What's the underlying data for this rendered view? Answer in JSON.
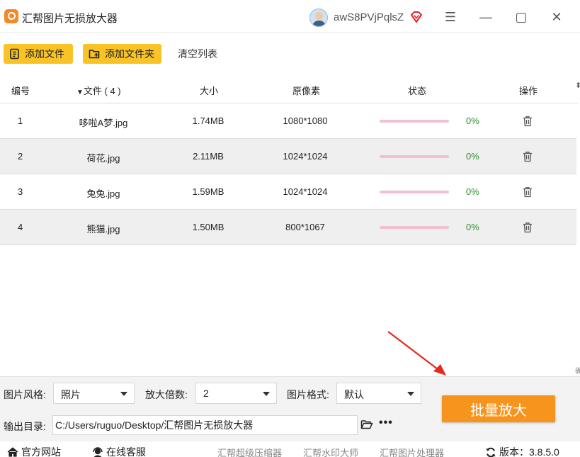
{
  "window": {
    "title": "汇帮图片无损放大器",
    "username": "awS8PVjPqlsZ",
    "controls": {
      "menu": "☰",
      "minimize": "—",
      "maximize": "▢",
      "close": "✕"
    }
  },
  "toolbar": {
    "add_file_label": "添加文件",
    "add_folder_label": "添加文件夹",
    "clear_list_label": "清空列表"
  },
  "table": {
    "headers": {
      "index": "编号",
      "file": "文件 ( 4 )",
      "size": "大小",
      "pixels": "原像素",
      "status": "状态",
      "action": "操作"
    },
    "rows": [
      {
        "index": "1",
        "file": "哆啦A梦.jpg",
        "size": "1.74MB",
        "pixels": "1080*1080",
        "progress": 0,
        "percent": "0%"
      },
      {
        "index": "2",
        "file": "荷花.jpg",
        "size": "2.11MB",
        "pixels": "1024*1024",
        "progress": 0,
        "percent": "0%"
      },
      {
        "index": "3",
        "file": "兔兔.jpg",
        "size": "1.59MB",
        "pixels": "1024*1024",
        "progress": 0,
        "percent": "0%"
      },
      {
        "index": "4",
        "file": "熊猫.jpg",
        "size": "1.50MB",
        "pixels": "800*1067",
        "progress": 0,
        "percent": "0%"
      }
    ]
  },
  "settings": {
    "style_label": "图片风格:",
    "style_value": "照片",
    "scale_label": "放大倍数:",
    "scale_value": "2",
    "format_label": "图片格式:",
    "format_value": "默认",
    "output_label": "输出目录:",
    "output_path": "C:/Users/ruguo/Desktop/汇帮图片无损放大器",
    "more_label": "•••",
    "start_button_label": "批量放大"
  },
  "footer": {
    "website_label": "官方网站",
    "support_label": "在线客服",
    "links": [
      "汇帮超级压缩器",
      "汇帮水印大师",
      "汇帮图片处理器"
    ],
    "version_label": "版本：",
    "version_value": "3.8.5.0"
  },
  "colors": {
    "accent_yellow": "#f9c225",
    "primary_orange": "#f7941d",
    "progress_track": "#f1c1cf",
    "percent_green": "#2f8f2f",
    "annotation_red": "#e8271f"
  }
}
